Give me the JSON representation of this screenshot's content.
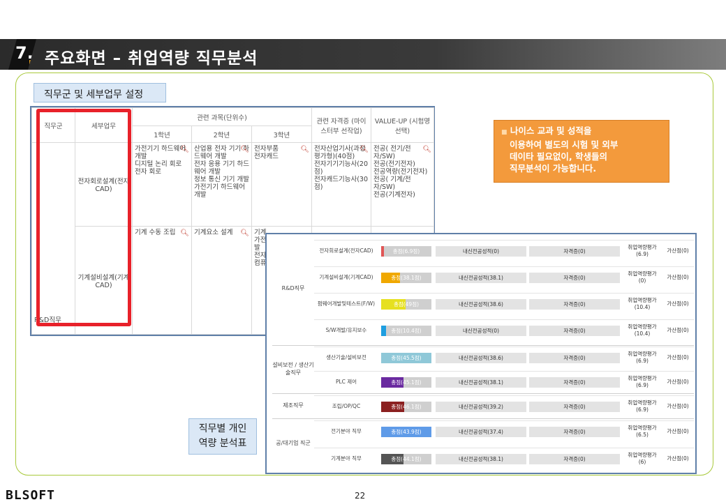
{
  "header": {
    "number": "7.",
    "title": "주요화면 – 취업역량 직무분석"
  },
  "section1_label": "직무군 및 세부업무 설정",
  "table": {
    "h_group": "직무군",
    "h_task": "세부업무",
    "h_subjects": "관련 과목(단위수)",
    "h_year1": "1학년",
    "h_year2": "2학년",
    "h_year3": "3학년",
    "h_cert": "관련 자격증 (마이스터부 선작업)",
    "h_valueup": "VALUE-UP (시험명 선택)",
    "group_name": "R&D직무",
    "row1": {
      "task": "전자회로설계(전자CAD)",
      "y1": [
        "가전기기 하드웨어 개발",
        "디지털 논리 회로",
        "전자 회로"
      ],
      "y2": [
        "산업용 전자 기기 하드웨어 개발",
        "전자 응용 기기 하드웨어 개발",
        "정보 통신 기기 개발",
        "가전기기 하드웨어 개발"
      ],
      "y3": [
        "전자부품",
        "전자캐드"
      ],
      "cert": [
        "전자산업기사(과정평가형)(40점)",
        "전자기기기능사(20점)",
        "전자캐드기능사(30점)"
      ],
      "vu": [
        "전공( 전기/전자/SW)",
        "전공(전기전자)",
        "전공역량(전기전자)",
        "전공( 기계/전자/SW)",
        "전공(기계전자)"
      ]
    },
    "row2": {
      "task": "기계설비설계(기계CAD)",
      "y1": [
        "기계 수동 조립"
      ],
      "y2": [
        "기계요소 설계"
      ],
      "y3": [
        "기계",
        "가전",
        "발",
        "전자",
        "컴퓨"
      ]
    }
  },
  "note": {
    "lines": [
      "나이스 교과 및 성적을",
      "이용하여 별도의 시험 및 외부",
      "데이타 필요없이, 학생들의",
      "직무분석이 가능합니다."
    ]
  },
  "panel_label": [
    "직무별 개인",
    "역량 분석표"
  ],
  "analysis": {
    "groups": [
      "R&D직무",
      "설비보전 / 생산기술직무",
      "제조직무",
      "공/대기업 직군"
    ],
    "rows": [
      {
        "name": "전자회로설계(전자CAD)",
        "score": "총점(6.9점)",
        "pct": 0.06,
        "color": "#e05555",
        "gpa": "내신전공성적(0)",
        "cert": "자격증(0)",
        "eval": [
          "취업역량평가",
          "(6.9)"
        ],
        "add": "가산점(0)"
      },
      {
        "name": "기계설비설계(기계CAD)",
        "score": "총점(38.1점)",
        "pct": 0.38,
        "color": "#f0a800",
        "gpa": "내신전공성적(38.1)",
        "cert": "자격증(0)",
        "eval": [
          "취업역량평가",
          "(0)"
        ],
        "add": "가산점(0)"
      },
      {
        "name": "펌웨어개발및테스트(F/W)",
        "score": "총점(49점)",
        "pct": 0.49,
        "color": "#e6e020",
        "gpa": "내신전공성적(38.6)",
        "cert": "자격증(0)",
        "eval": [
          "취업역량평가",
          "(10.4)"
        ],
        "add": "가산점(0)"
      },
      {
        "name": "S/W개발/유지보수",
        "score": "총점(10.4점)",
        "pct": 0.1,
        "color": "#1e9ee0",
        "gpa": "내신전공성적(0)",
        "cert": "자격증(0)",
        "eval": [
          "취업역량평가",
          "(10.4)"
        ],
        "add": "가산점(0)"
      },
      {
        "name": "생산기술/설비보전",
        "score": "총점(45.5점)",
        "pct": 1.0,
        "color": "#8fc8d8",
        "gpa": "내신전공성적(38.6)",
        "cert": "자격증(0)",
        "eval": [
          "취업역량평가",
          "(6.9)"
        ],
        "add": "가산점(0)"
      },
      {
        "name": "PLC 제어",
        "score": "총점(45.1점)",
        "pct": 0.45,
        "color": "#6a2aa0",
        "gpa": "내신전공성적(38.1)",
        "cert": "자격증(0)",
        "eval": [
          "취업역량평가",
          "(6.9)"
        ],
        "add": "가산점(0)"
      },
      {
        "name": "조립/OP/QC",
        "score": "총점(46.1점)",
        "pct": 0.46,
        "color": "#8b2020",
        "gpa": "내신전공성적(39.2)",
        "cert": "자격증(0)",
        "eval": [
          "취업역량평가",
          "(6.9)"
        ],
        "add": "가산점(0)"
      },
      {
        "name": "전기분야 직무",
        "score": "총점(43.9점)",
        "pct": 1.0,
        "color": "#5f9be8",
        "gpa": "내신전공성적(37.4)",
        "cert": "자격증(0)",
        "eval": [
          "취업역량평가",
          "(6.5)"
        ],
        "add": "가산점(0)"
      },
      {
        "name": "기계분야 직무",
        "score": "총점(44.1점)",
        "pct": 0.44,
        "color": "#555555",
        "gpa": "내신전공성적(38.1)",
        "cert": "자격증(0)",
        "eval": [
          "취업역량평가",
          "(6)"
        ],
        "add": "가산점(0)"
      }
    ]
  },
  "footer": {
    "logo": "BLSOFT",
    "page": "22"
  }
}
